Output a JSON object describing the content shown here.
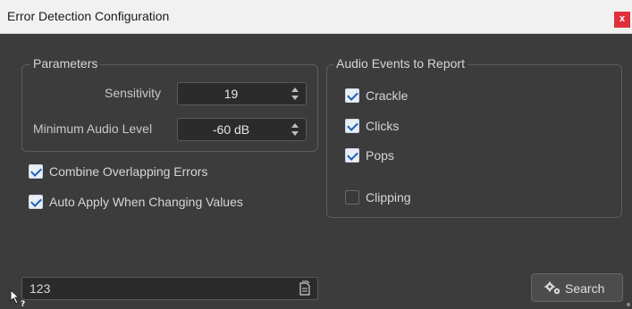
{
  "window": {
    "title": "Error Detection Configuration",
    "close_label": "x"
  },
  "parameters": {
    "title": "Parameters",
    "sensitivity": {
      "label": "Sensitivity",
      "value": "19"
    },
    "min_audio_level": {
      "label": "Minimum Audio Level",
      "value": "-60 dB"
    }
  },
  "options": {
    "combine_overlapping": {
      "label": "Combine Overlapping Errors",
      "checked": true
    },
    "auto_apply": {
      "label": "Auto Apply When Changing Values",
      "checked": true
    }
  },
  "audio_events": {
    "title": "Audio Events to Report",
    "items": [
      {
        "label": "Crackle",
        "checked": true
      },
      {
        "label": "Clicks",
        "checked": true
      },
      {
        "label": "Pops",
        "checked": true
      },
      {
        "label": "Clipping",
        "checked": false
      }
    ]
  },
  "footer": {
    "count_value": "123",
    "search_label": "Search"
  },
  "icons": {
    "close": "close-icon",
    "spin_arrows": "spin-arrows-icon",
    "document": "document-icon",
    "search_button": "gears-icon",
    "help_cursor": "help-cursor-icon"
  },
  "colors": {
    "checkmark": "#1c62b8",
    "close_button": "#e0303c",
    "background": "#3c3c3c"
  }
}
